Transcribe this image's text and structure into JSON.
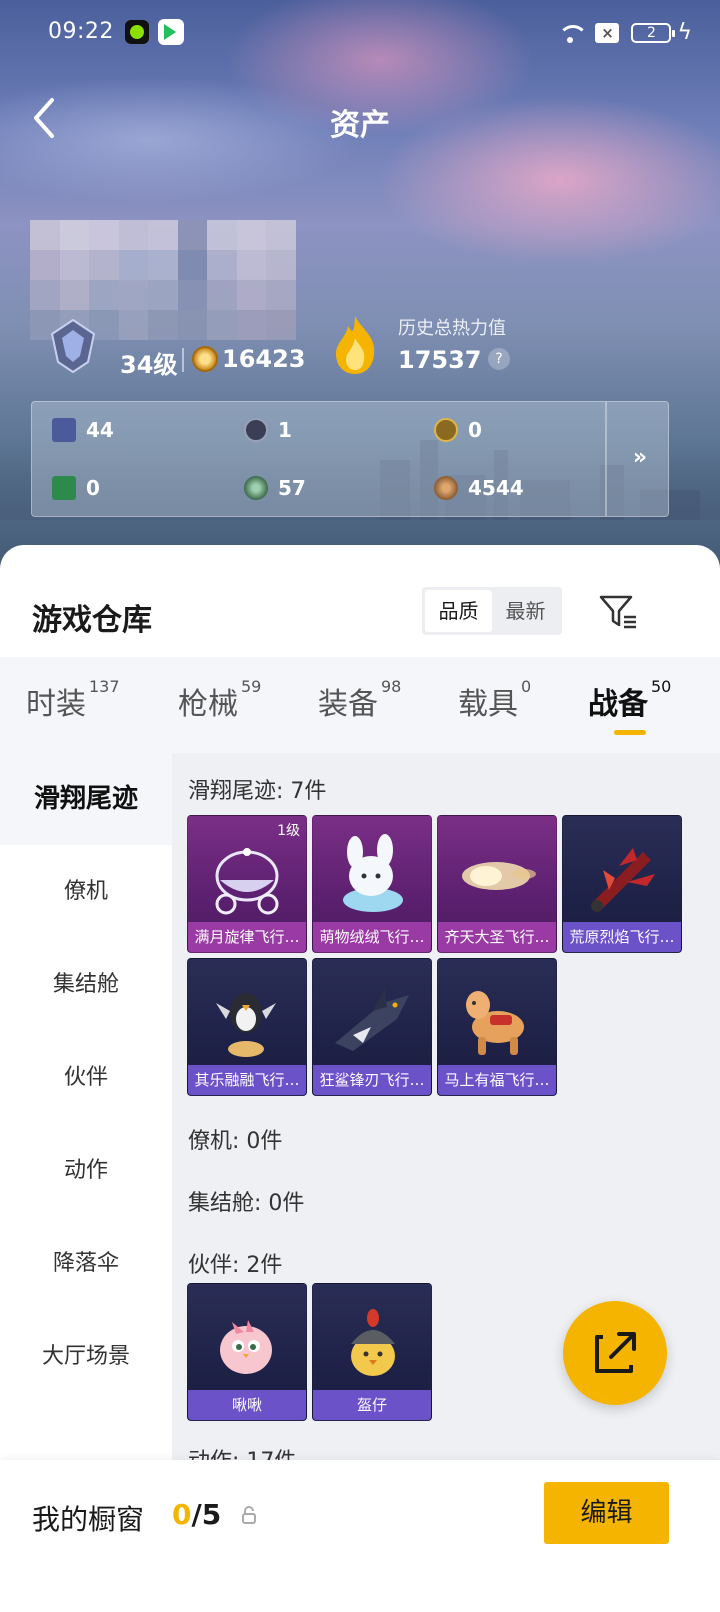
{
  "statusbar": {
    "time": "09:22",
    "sim": "×",
    "battery": "2",
    "bolt": "ϟ"
  },
  "header": {
    "title": "资产"
  },
  "profile": {
    "level": "34级",
    "coins": "16423",
    "heat_label": "历史总热力值",
    "heat_value": "17537",
    "help": "?"
  },
  "resources": [
    {
      "value": "44",
      "icon": "card-icon",
      "color": "#4a5a9a"
    },
    {
      "value": "1",
      "icon": "token-icon",
      "color": "#3a3f55"
    },
    {
      "value": "0",
      "icon": "gold-token-icon",
      "color": "#8a6a20"
    },
    {
      "value": "0",
      "icon": "green-card-icon",
      "color": "#2e8a4a"
    },
    {
      "value": "57",
      "icon": "gem-icon",
      "color": "#3a6a4a"
    },
    {
      "value": "4544",
      "icon": "bronze-coin-icon",
      "color": "#8a5a30"
    }
  ],
  "resources_more": "»",
  "warehouse": {
    "title": "游戏仓库",
    "sort_quality": "品质",
    "sort_newest": "最新"
  },
  "tabs": [
    {
      "label": "时装",
      "count": "137"
    },
    {
      "label": "枪械",
      "count": "59"
    },
    {
      "label": "装备",
      "count": "98"
    },
    {
      "label": "载具",
      "count": "0"
    },
    {
      "label": "战备",
      "count": "50"
    }
  ],
  "sidebar": [
    {
      "label": "滑翔尾迹"
    },
    {
      "label": "僚机"
    },
    {
      "label": "集结舱"
    },
    {
      "label": "伙伴"
    },
    {
      "label": "动作"
    },
    {
      "label": "降落伞"
    },
    {
      "label": "大厅场景"
    }
  ],
  "sections": {
    "trails_title": "滑翔尾迹: 7件",
    "wingman_title": "僚机: 0件",
    "capsule_title": "集结舱: 0件",
    "partner_title": "伙伴: 2件",
    "action_title": "动作: 17件"
  },
  "trail_items": [
    {
      "name": "满月旋律飞行…",
      "level": "1级",
      "rarity": "purple"
    },
    {
      "name": "萌物绒绒飞行…",
      "level": "",
      "rarity": "purple"
    },
    {
      "name": "齐天大圣飞行…",
      "level": "",
      "rarity": "purple"
    },
    {
      "name": "荒原烈焰飞行…",
      "level": "",
      "rarity": "dark"
    },
    {
      "name": "其乐融融飞行…",
      "level": "",
      "rarity": "dark"
    },
    {
      "name": "狂鲨锋刃飞行…",
      "level": "",
      "rarity": "dark"
    },
    {
      "name": "马上有福飞行…",
      "level": "",
      "rarity": "dark"
    }
  ],
  "partner_items": [
    {
      "name": "啾啾",
      "rarity": "dark"
    },
    {
      "name": "盔仔",
      "rarity": "dark"
    }
  ],
  "showcase": {
    "label": "我的橱窗",
    "current": "0",
    "total": "/5",
    "edit": "编辑"
  },
  "colors": {
    "accent": "#f5b400",
    "purple_tier": "#9a3aa5",
    "blue_tier": "#6b52c9"
  }
}
